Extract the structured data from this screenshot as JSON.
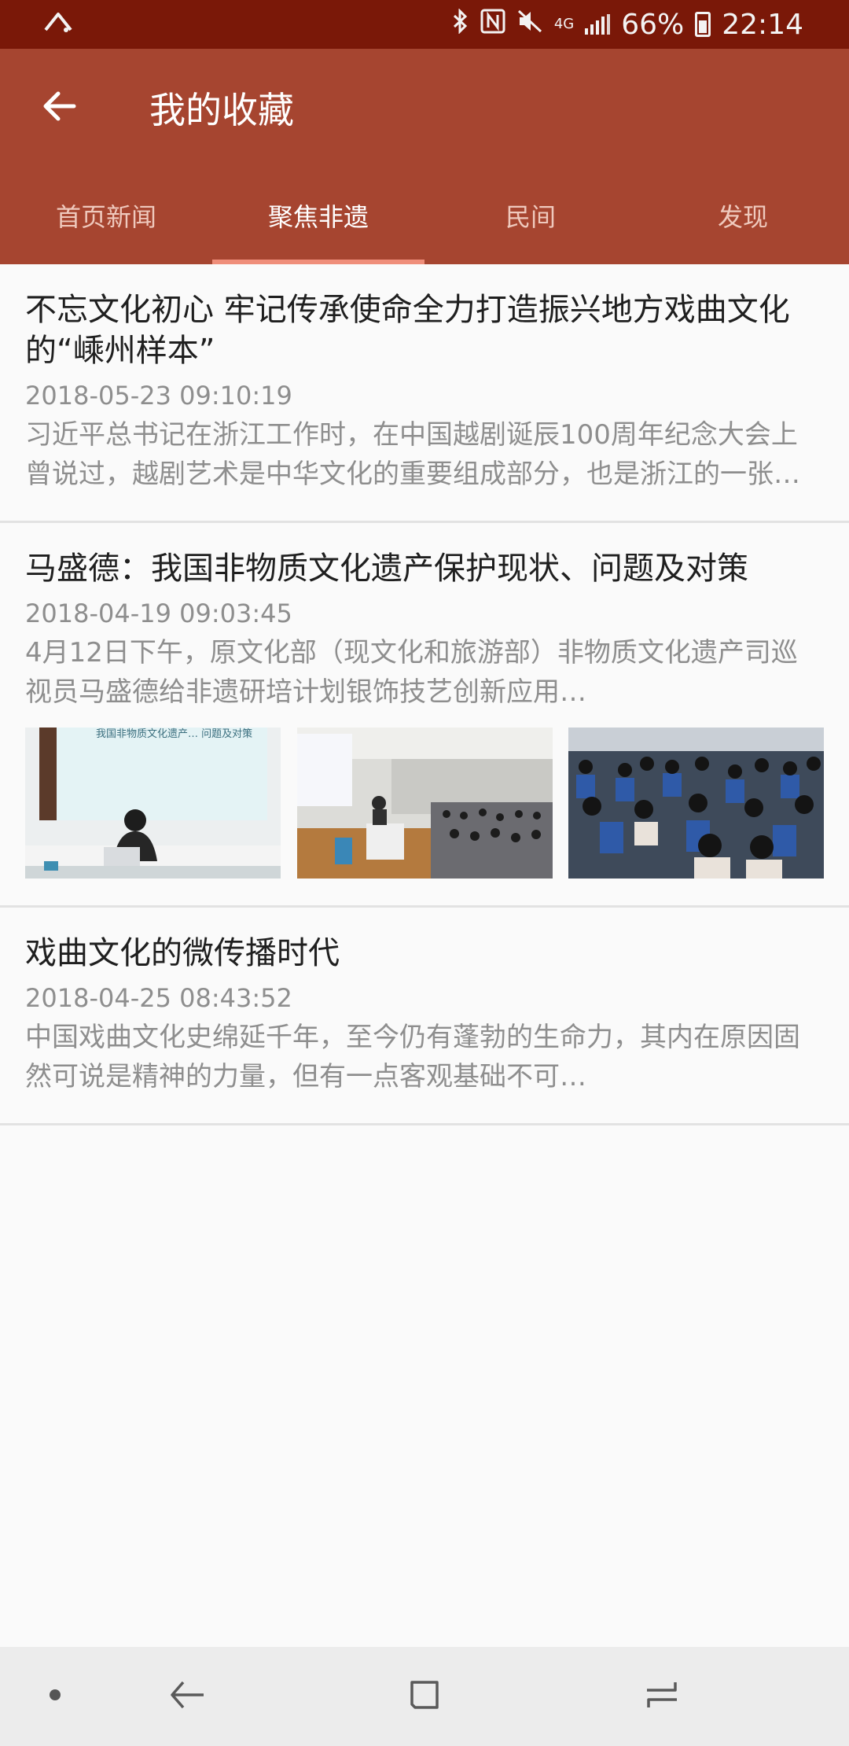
{
  "status_bar": {
    "battery": "66%",
    "time": "22:14",
    "net": "4G",
    "icons": [
      "app-notification-icon",
      "bluetooth-icon",
      "nfc-icon",
      "mute-icon",
      "signal-icon",
      "battery-icon"
    ]
  },
  "app_bar": {
    "title": "我的收藏",
    "back_icon": "arrow-left-icon"
  },
  "tabs": [
    {
      "label": "首页新闻",
      "active": false
    },
    {
      "label": "聚焦非遗",
      "active": true
    },
    {
      "label": "民间",
      "active": false
    },
    {
      "label": "发现",
      "active": false
    }
  ],
  "articles": [
    {
      "title": "不忘文化初心 牢记传承使命全力打造振兴地方戏曲文化的“嵊州样本”",
      "date": "2018-05-23 09:10:19",
      "summary": "习近平总书记在浙江工作时，在中国越剧诞辰100周年纪念大会上曾说过，越剧艺术是中华文化的重要组成部分，也是浙江的一张金名片…"
    },
    {
      "title": "马盛德：我国非物质文化遗产保护现状、问题及对策",
      "date": "2018-04-19 09:03:45",
      "summary": "4月12日下午，原文化部（现文化和旅游部）非物质文化遗产司巡视员马盛德给非遗研培计划银饰技艺创新应用…",
      "thumb_caption": "我国非物质文化遗产… 问题及对策"
    },
    {
      "title": "戏曲文化的微传播时代",
      "date": "2018-04-25 08:43:52",
      "summary": "中国戏曲文化史绵延千年，至今仍有蓬勃的生命力，其内在原因固然可说是精神的力量，但有一点客观基础不可…"
    }
  ],
  "nav_bar": {
    "icons": [
      "nav-dot-icon",
      "nav-back-icon",
      "nav-home-icon",
      "nav-recents-icon"
    ]
  },
  "colors": {
    "status_bar": "#7a1808",
    "app_bar": "#a64530",
    "tab_indicator": "#ef8e7a",
    "background": "#fafafa"
  }
}
